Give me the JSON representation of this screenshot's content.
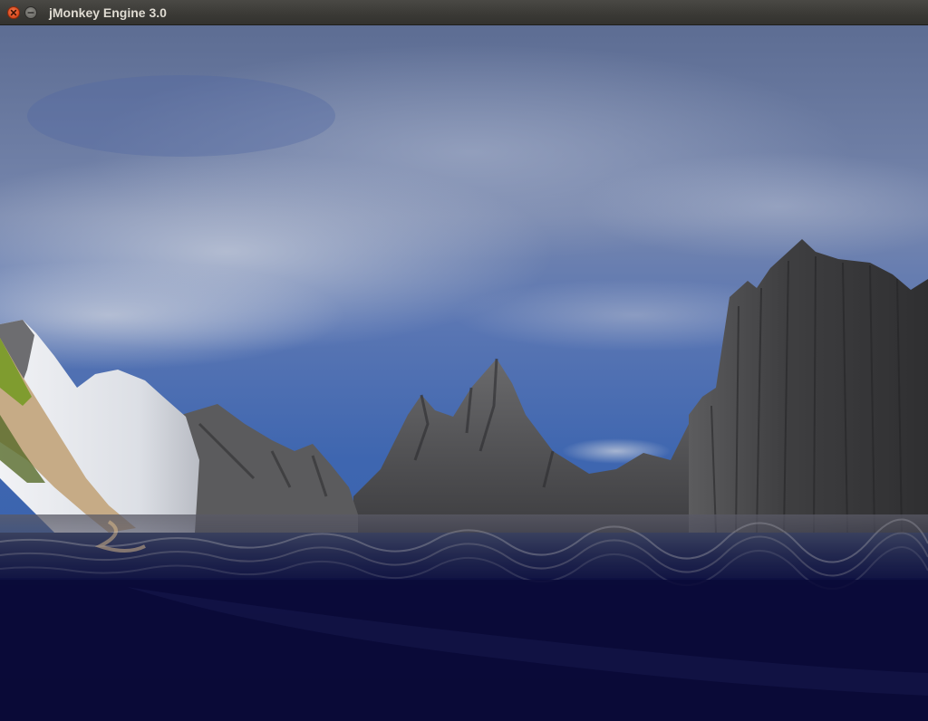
{
  "window": {
    "title": "jMonkey Engine 3.0",
    "controls": [
      "close-icon",
      "minimize-icon"
    ]
  },
  "scene": {
    "description_colors": {
      "sky_top": "#5e6f96",
      "sky_mid": "#8293b9",
      "sky_low": "#3b62ad",
      "water": "#0a0b3a",
      "rock": "#4a4a4c",
      "snow": "#e9ebef",
      "grass": "#7f9c2f",
      "sand": "#c7ab86"
    }
  }
}
